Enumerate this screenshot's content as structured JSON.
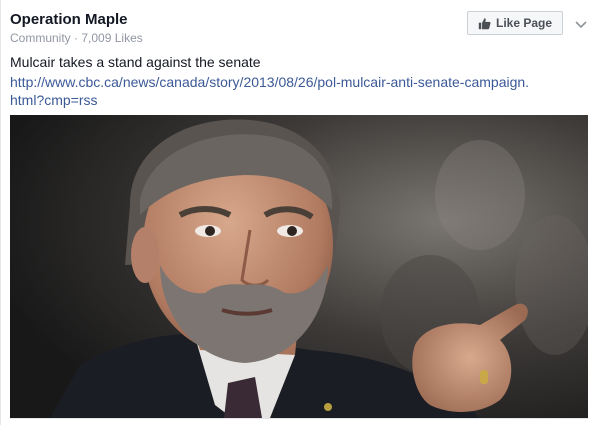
{
  "page": {
    "name": "Operation Maple",
    "category": "Community",
    "separator": "·",
    "likes": "7,009 Likes"
  },
  "like_button": {
    "label": "Like Page",
    "icon": "thumbs-up-icon"
  },
  "menu": {
    "icon": "chevron-down-icon"
  },
  "post": {
    "text": "Mulcair takes a stand against the senate",
    "link": "http://www.cbc.ca/news/canada/story/2013/08/26/pol-mulcair-anti-senate-campaign.html?cmp=rss"
  },
  "colors": {
    "link": "#3b5998",
    "meta": "#9197a3",
    "text": "#141823",
    "button_bg": "#f6f7f9",
    "button_border": "#ccd0d5"
  }
}
